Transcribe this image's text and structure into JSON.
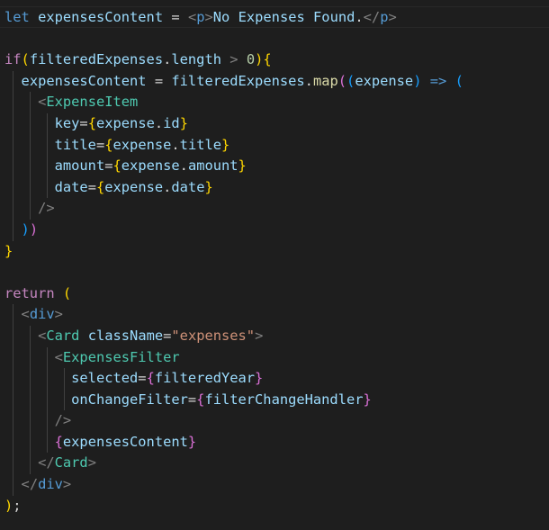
{
  "editor": {
    "lines": [
      "let expensesContent = <p>No Expenses Found.</p>",
      "",
      "if(filteredExpenses.length > 0){",
      "  expensesContent = filteredExpenses.map((expense) => (",
      "    <ExpenseItem",
      "      key={expense.id}",
      "      title={expense.title}",
      "      amount={expense.amount}",
      "      date={expense.date}",
      "    />",
      "  ))",
      "}",
      "",
      "return (",
      "  <div>",
      "    <Card className=\"expenses\">",
      "      <ExpensesFilter",
      "        selected={filteredYear}",
      "        onChangeFilter={filterChangeHandler}",
      "      />",
      "      {expensesContent}",
      "    </Card>",
      "  </div>",
      ");"
    ]
  },
  "theme": {
    "background": "#1e1e1e",
    "keyword": "#c586c0",
    "declaration": "#569cd6",
    "variable": "#9cdcfe",
    "function": "#dcdcaa",
    "component": "#4ec9b0",
    "string": "#ce9178",
    "number": "#b5cea8"
  }
}
